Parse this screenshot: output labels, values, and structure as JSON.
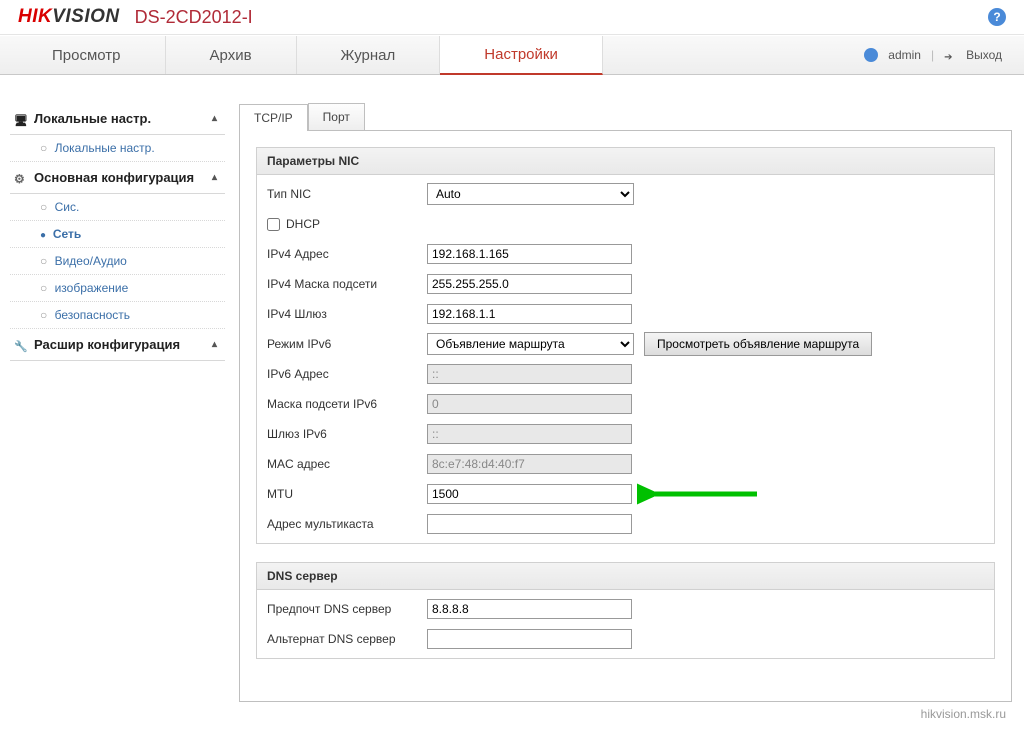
{
  "brand": {
    "part1": "HIK",
    "part2": "VISION"
  },
  "model": "DS-2CD2012-I",
  "nav": {
    "tabs": [
      "Просмотр",
      "Архив",
      "Журнал",
      "Настройки"
    ],
    "active_index": 3,
    "user": "admin",
    "logout": "Выход"
  },
  "sidebar": {
    "groups": [
      {
        "label": "Локальные настр.",
        "icon": "monitor",
        "items": [
          "Локальные настр."
        ]
      },
      {
        "label": "Основная конфигурация",
        "icon": "gear",
        "items": [
          "Сис.",
          "Сеть",
          "Видео/Аудио",
          "изображение",
          "безопасность"
        ],
        "active_item": 1
      },
      {
        "label": "Расшир конфигурация",
        "icon": "wrench",
        "items": []
      }
    ]
  },
  "subtabs": {
    "items": [
      "TCP/IP",
      "Порт"
    ],
    "active_index": 0
  },
  "nic": {
    "legend": "Параметры NIC",
    "labels": {
      "nic_type": "Тип NIC",
      "dhcp": "DHCP",
      "ipv4_addr": "IPv4 Адрес",
      "ipv4_mask": "IPv4 Маска подсети",
      "ipv4_gw": "IPv4 Шлюз",
      "ipv6_mode": "Режим IPv6",
      "ipv6_addr": "IPv6 Адрес",
      "ipv6_mask": "Маска подсети IPv6",
      "ipv6_gw": "Шлюз IPv6",
      "mac": "MAC адрес",
      "mtu": "MTU",
      "multicast": "Адрес мультикаста"
    },
    "values": {
      "nic_type": "Auto",
      "dhcp_checked": false,
      "ipv4_addr": "192.168.1.165",
      "ipv4_mask": "255.255.255.0",
      "ipv4_gw": "192.168.1.1",
      "ipv6_mode": "Объявление маршрута",
      "ipv6_addr": "::",
      "ipv6_mask": "0",
      "ipv6_gw": "::",
      "mac": "8c:e7:48:d4:40:f7",
      "mtu": "1500",
      "multicast": ""
    },
    "view_route_btn": "Просмотреть объявление маршрута"
  },
  "dns": {
    "legend": "DNS сервер",
    "labels": {
      "pref": "Предпочт DNS сервер",
      "alt": "Альтернат DNS сервер"
    },
    "values": {
      "pref": "8.8.8.8",
      "alt": ""
    }
  },
  "watermark": "hikvision.msk.ru"
}
